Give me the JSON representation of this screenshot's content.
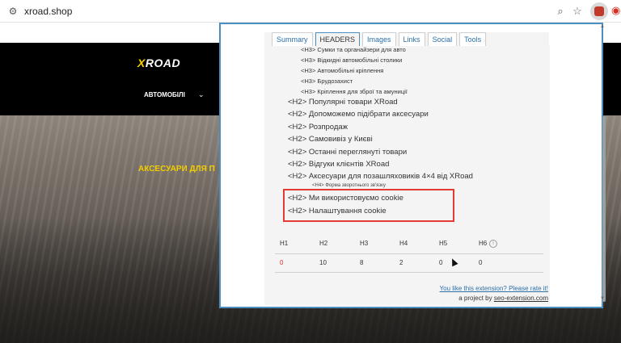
{
  "browser": {
    "url": "xroad.shop",
    "icons": [
      "site-info-icon",
      "zoom-icon",
      "star-icon",
      "extension-icon",
      "location-pin-icon"
    ]
  },
  "site": {
    "logo": "XROAD",
    "nav_item": "АВТОМОБІЛІ",
    "hero_text": "АКСЕСУАРИ ДЛЯ П"
  },
  "popup": {
    "tabs": [
      "Summary",
      "HEADERS",
      "Images",
      "Links",
      "Social",
      "Tools"
    ],
    "active_tab": "HEADERS",
    "h3_items": [
      "<H3> Сумки та органайзери для авто",
      "<H3> Відкидні автомобільні столики",
      "<H3> Автомобільні кріплення",
      "<H3> Брудозахист",
      "<H3> Кріплення для зброї та амуниції"
    ],
    "h2_items": [
      "<H2> Популярні товари XRoad",
      "<H2> Допоможемо підібрати аксесуари",
      "<H2> Розпродаж",
      "<H2> Самовивіз у Києві",
      "<H2> Останні переглянуті товари",
      "<H2> Відгуки клієнтів XRoad",
      "<H2> Аксесуари для позашляховиків 4×4 від XRoad"
    ],
    "h4_item": "<H4> Форма зворотнього зв'язку",
    "highlighted_items": [
      "<H2> Ми використовуємо cookie",
      "<H2> Налаштування cookie"
    ],
    "stats": {
      "headers": [
        "H1",
        "H2",
        "H3",
        "H4",
        "H5",
        "H6"
      ],
      "values": [
        "0",
        "10",
        "8",
        "2",
        "0",
        "0"
      ]
    },
    "rate_link": "You like this extension? Please rate it!",
    "project_prefix": "a project by",
    "project_link": "seo-extension.com"
  },
  "colors": {
    "popup_border": "#4a8fc2",
    "highlight_border": "#e53935",
    "brand_yellow": "#f7d000"
  }
}
